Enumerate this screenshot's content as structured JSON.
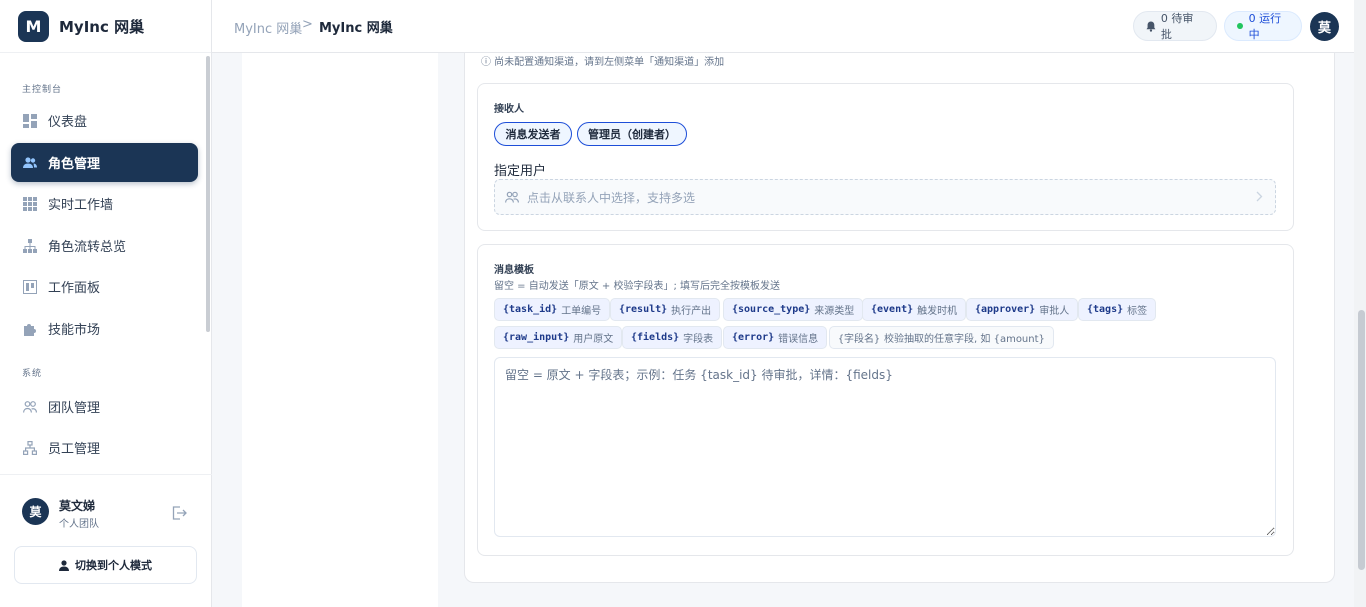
{
  "brand": {
    "logo_letter": "M",
    "name": "MyInc 网巢"
  },
  "sidebar": {
    "section_main": "主控制台",
    "section_system": "系统",
    "items": [
      {
        "label": "仪表盘",
        "icon": "dashboard-icon"
      },
      {
        "label": "角色管理",
        "icon": "users-icon",
        "active": true
      },
      {
        "label": "实时工作墙",
        "icon": "grid-icon"
      },
      {
        "label": "角色流转总览",
        "icon": "hierarchy-icon"
      },
      {
        "label": "工作面板",
        "icon": "panel-icon"
      },
      {
        "label": "技能市场",
        "icon": "puzzle-icon"
      }
    ],
    "system_items": [
      {
        "label": "团队管理",
        "icon": "team-icon"
      },
      {
        "label": "员工管理",
        "icon": "org-icon"
      }
    ]
  },
  "user": {
    "avatar": "莫",
    "name": "莫文娣",
    "team": "个人团队",
    "switch_label": "切换到个人模式"
  },
  "topbar": {
    "breadcrumb_root": "MyInc 网巢",
    "breadcrumb_sep": ">",
    "breadcrumb_current": "MyInc 网巢",
    "pending_label": "0 待审批",
    "running_label": "0 运行中",
    "avatar": "莫"
  },
  "form": {
    "channel_hint": "ⓘ 尚未配置通知渠道，请到左侧菜单「通知渠道」添加",
    "receivers": {
      "title": "接收人",
      "chips": [
        "消息发送者",
        "管理员（创建者）"
      ],
      "assign_title": "指定用户",
      "picker_placeholder": "点击从联系人中选择，支持多选"
    },
    "template": {
      "title": "消息模板",
      "description": "留空 = 自动发送「原文 + 校验字段表」; 填写后完全按模板发送",
      "variables_row1": [
        {
          "code": "{task_id}",
          "desc": "工单编号"
        },
        {
          "code": "{result}",
          "desc": "执行产出"
        },
        {
          "code": "{source_type}",
          "desc": "来源类型"
        },
        {
          "code": "{event}",
          "desc": "触发时机"
        },
        {
          "code": "{approver}",
          "desc": "审批人"
        },
        {
          "code": "{tags}",
          "desc": "标签"
        }
      ],
      "variables_row2": [
        {
          "code": "{raw_input}",
          "desc": "用户原文"
        },
        {
          "code": "{fields}",
          "desc": "字段表"
        },
        {
          "code": "{error}",
          "desc": "错误信息"
        },
        {
          "code": "{字段名}",
          "desc": "校验抽取的任意字段, 如 {amount}"
        }
      ],
      "placeholder": "留空 = 原文 + 字段表；示例：任务 {task_id} 待审批，详情：{fields}"
    }
  },
  "colors": {
    "primary": "#1b3555",
    "accent": "#1d4ed8",
    "running_dot": "#22c55e"
  }
}
